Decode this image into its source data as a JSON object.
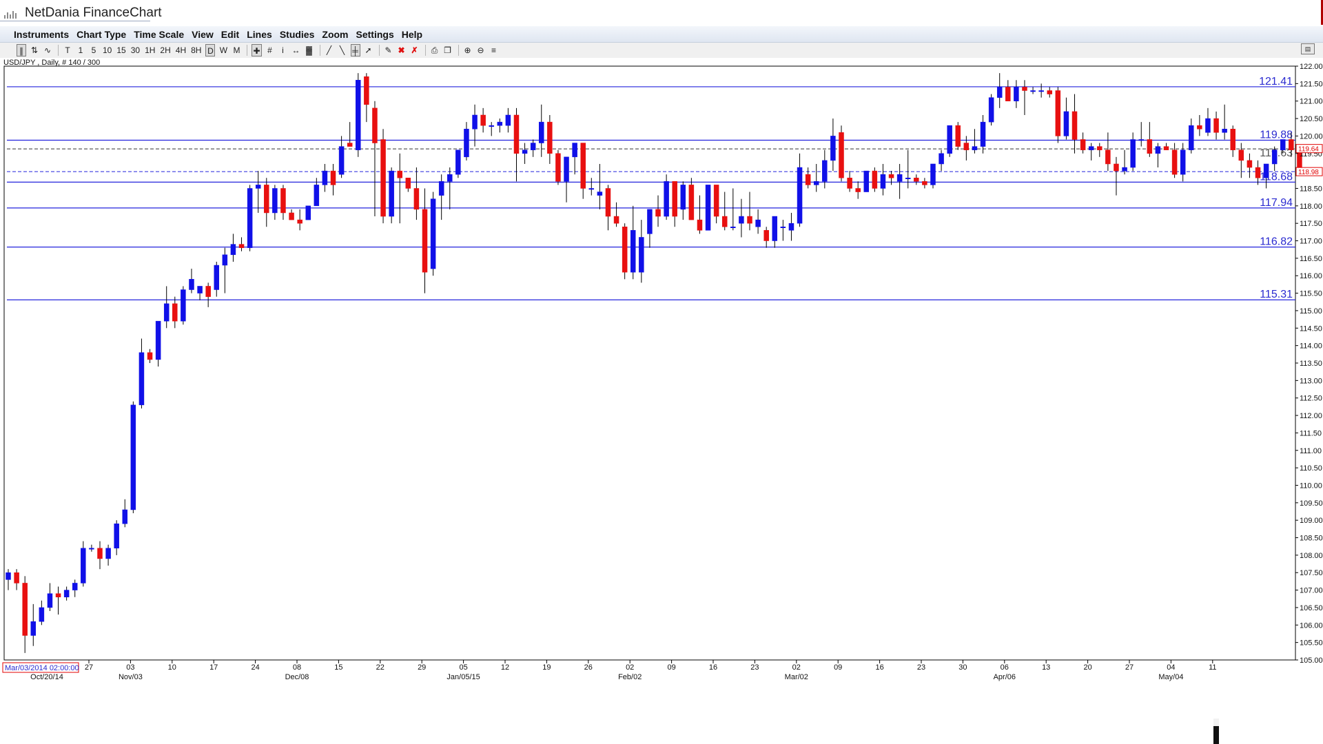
{
  "app": {
    "title": "NetDania FinanceChart"
  },
  "menu": [
    "Instruments",
    "Chart Type",
    "Time Scale",
    "View",
    "Edit",
    "Lines",
    "Studies",
    "Zoom",
    "Settings",
    "Help"
  ],
  "toolbar": {
    "timeframes": [
      "T",
      "1",
      "5",
      "10",
      "15",
      "30",
      "1H",
      "2H",
      "4H",
      "8H",
      "D",
      "W",
      "M"
    ],
    "active_timeframe": "D"
  },
  "symbol_label": "USD/JPY , Daily, # 140 / 300",
  "colors": {
    "up": "#1010e8",
    "down": "#e81010",
    "line": "#2222dd",
    "text_blue": "#2a2ad0",
    "price_red": "#e00000"
  },
  "chart_data": {
    "type": "candlestick",
    "title": "",
    "symbol": "USD/JPY",
    "interval": "Daily",
    "ylim": [
      105.0,
      122.0
    ],
    "y_ticks": [
      "122.00",
      "121.50",
      "121.00",
      "120.50",
      "120.00",
      "119.50",
      "119.00",
      "118.50",
      "118.00",
      "117.50",
      "117.00",
      "116.50",
      "116.00",
      "115.50",
      "115.00",
      "114.50",
      "114.00",
      "113.50",
      "113.00",
      "112.50",
      "112.00",
      "111.50",
      "111.00",
      "110.50",
      "110.00",
      "109.50",
      "109.00",
      "108.50",
      "108.00",
      "107.50",
      "107.00",
      "106.50",
      "106.00",
      "105.50",
      "105.00"
    ],
    "x_ticks": [
      {
        "label": "27",
        "sub": ""
      },
      {
        "label": "03",
        "sub": "Nov/03"
      },
      {
        "label": "10",
        "sub": ""
      },
      {
        "label": "17",
        "sub": ""
      },
      {
        "label": "24",
        "sub": ""
      },
      {
        "label": "08",
        "sub": "Dec/08"
      },
      {
        "label": "15",
        "sub": ""
      },
      {
        "label": "22",
        "sub": ""
      },
      {
        "label": "29",
        "sub": ""
      },
      {
        "label": "05",
        "sub": "Jan/05/15"
      },
      {
        "label": "12",
        "sub": ""
      },
      {
        "label": "19",
        "sub": ""
      },
      {
        "label": "26",
        "sub": ""
      },
      {
        "label": "02",
        "sub": "Feb/02"
      },
      {
        "label": "09",
        "sub": ""
      },
      {
        "label": "16",
        "sub": ""
      },
      {
        "label": "23",
        "sub": ""
      },
      {
        "label": "02",
        "sub": "Mar/02"
      },
      {
        "label": "09",
        "sub": ""
      },
      {
        "label": "16",
        "sub": ""
      },
      {
        "label": "23",
        "sub": ""
      },
      {
        "label": "30",
        "sub": ""
      },
      {
        "label": "06",
        "sub": "Apr/06"
      },
      {
        "label": "13",
        "sub": ""
      },
      {
        "label": "20",
        "sub": ""
      },
      {
        "label": "27",
        "sub": ""
      },
      {
        "label": "04",
        "sub": "May/04"
      },
      {
        "label": "11",
        "sub": ""
      }
    ],
    "x_first_sub": "Oct/20/14",
    "cursor_date_label": "Mar/03/2014 02:00:00",
    "horizontal_lines": [
      {
        "value": 121.41,
        "label": "121.41"
      },
      {
        "value": 119.88,
        "label": "119.88"
      },
      {
        "value": 118.68,
        "label": "118.68"
      },
      {
        "value": 117.94,
        "label": "117.94"
      },
      {
        "value": 116.82,
        "label": "116.82"
      },
      {
        "value": 115.31,
        "label": "115.31"
      }
    ],
    "dashed_lines": [
      {
        "value": 119.63,
        "label": "119.63"
      },
      {
        "value": 118.98,
        "label": "118.98"
      }
    ],
    "price_tags": [
      {
        "value": 119.64,
        "label": "119.64"
      },
      {
        "value": 118.98,
        "label": "118.98"
      }
    ],
    "candles": [
      [
        107.3,
        107.6,
        107.0,
        107.5
      ],
      [
        107.5,
        107.6,
        107.0,
        107.2
      ],
      [
        107.2,
        107.4,
        105.2,
        105.7
      ],
      [
        105.7,
        106.6,
        105.4,
        106.1
      ],
      [
        106.1,
        106.7,
        106.0,
        106.5
      ],
      [
        106.5,
        107.2,
        106.4,
        106.9
      ],
      [
        106.9,
        107.1,
        106.3,
        106.8
      ],
      [
        106.8,
        107.1,
        106.7,
        107.0
      ],
      [
        107.0,
        107.3,
        106.8,
        107.2
      ],
      [
        107.2,
        108.4,
        107.1,
        108.2
      ],
      [
        108.2,
        108.3,
        108.1,
        108.2
      ],
      [
        108.2,
        108.4,
        107.6,
        107.9
      ],
      [
        107.9,
        108.3,
        107.7,
        108.2
      ],
      [
        108.2,
        109.0,
        108.0,
        108.9
      ],
      [
        108.9,
        109.6,
        108.8,
        109.3
      ],
      [
        109.3,
        112.4,
        109.2,
        112.3
      ],
      [
        112.3,
        114.2,
        112.2,
        113.8
      ],
      [
        113.8,
        113.9,
        113.5,
        113.6
      ],
      [
        113.6,
        114.7,
        113.4,
        114.7
      ],
      [
        114.7,
        115.7,
        114.5,
        115.2
      ],
      [
        115.2,
        115.4,
        114.5,
        114.7
      ],
      [
        114.7,
        115.7,
        114.6,
        115.6
      ],
      [
        115.6,
        116.2,
        115.5,
        115.9
      ],
      [
        115.5,
        115.7,
        115.3,
        115.7
      ],
      [
        115.7,
        115.8,
        115.1,
        115.4
      ],
      [
        115.6,
        116.4,
        115.4,
        116.3
      ],
      [
        116.3,
        116.8,
        115.5,
        116.6
      ],
      [
        116.6,
        117.2,
        116.4,
        116.9
      ],
      [
        116.9,
        117.1,
        116.7,
        116.8
      ],
      [
        116.8,
        118.6,
        116.7,
        118.5
      ],
      [
        118.5,
        119.0,
        117.8,
        118.6
      ],
      [
        118.6,
        118.8,
        117.4,
        117.8
      ],
      [
        117.8,
        118.6,
        117.6,
        118.5
      ],
      [
        118.5,
        118.6,
        117.6,
        117.8
      ],
      [
        117.8,
        117.9,
        117.6,
        117.6
      ],
      [
        117.6,
        117.9,
        117.3,
        117.5
      ],
      [
        117.6,
        118.0,
        117.6,
        118.0
      ],
      [
        118.0,
        118.8,
        118.0,
        118.6
      ],
      [
        118.6,
        119.2,
        118.4,
        119.0
      ],
      [
        119.0,
        119.2,
        118.3,
        118.6
      ],
      [
        118.9,
        120.0,
        118.8,
        119.7
      ],
      [
        119.8,
        120.4,
        119.7,
        119.7
      ],
      [
        119.6,
        121.8,
        119.4,
        121.6
      ],
      [
        121.7,
        121.8,
        120.4,
        120.9
      ],
      [
        120.8,
        121.0,
        117.7,
        119.8
      ],
      [
        119.9,
        120.2,
        117.5,
        117.7
      ],
      [
        117.7,
        119.1,
        117.5,
        119.0
      ],
      [
        119.0,
        119.5,
        117.5,
        118.8
      ],
      [
        118.8,
        118.5,
        118.4,
        118.5
      ],
      [
        118.5,
        119.1,
        117.6,
        117.9
      ],
      [
        117.9,
        118.5,
        115.5,
        116.1
      ],
      [
        116.2,
        118.4,
        116.0,
        118.2
      ],
      [
        118.3,
        118.9,
        117.6,
        118.7
      ],
      [
        118.7,
        119.1,
        117.9,
        118.9
      ],
      [
        118.9,
        119.6,
        118.8,
        119.6
      ],
      [
        119.4,
        120.4,
        119.3,
        120.2
      ],
      [
        120.2,
        120.9,
        119.7,
        120.6
      ],
      [
        120.6,
        120.8,
        120.1,
        120.3
      ],
      [
        120.3,
        120.4,
        120.0,
        120.3
      ],
      [
        120.3,
        120.5,
        120.1,
        120.4
      ],
      [
        120.3,
        120.8,
        120.1,
        120.6
      ],
      [
        120.6,
        120.8,
        118.7,
        119.5
      ],
      [
        119.5,
        119.8,
        119.2,
        119.6
      ],
      [
        119.6,
        119.9,
        119.4,
        119.8
      ],
      [
        119.8,
        120.9,
        119.4,
        120.4
      ],
      [
        120.4,
        120.6,
        119.2,
        119.5
      ],
      [
        119.5,
        119.6,
        118.6,
        118.7
      ],
      [
        118.7,
        119.4,
        118.1,
        119.4
      ],
      [
        119.4,
        119.8,
        118.9,
        119.8
      ],
      [
        119.8,
        119.8,
        118.2,
        118.5
      ],
      [
        118.5,
        118.8,
        118.3,
        118.5
      ],
      [
        118.3,
        119.2,
        117.9,
        118.4
      ],
      [
        118.5,
        118.6,
        117.3,
        117.7
      ],
      [
        117.7,
        118.1,
        117.4,
        117.5
      ],
      [
        117.4,
        117.5,
        115.9,
        116.1
      ],
      [
        116.1,
        118.0,
        115.9,
        117.3
      ],
      [
        116.1,
        117.6,
        115.8,
        117.1
      ],
      [
        117.2,
        117.9,
        116.8,
        117.9
      ],
      [
        117.9,
        118.3,
        117.4,
        117.7
      ],
      [
        117.7,
        118.9,
        117.6,
        118.7
      ],
      [
        118.7,
        118.7,
        117.4,
        117.7
      ],
      [
        117.9,
        118.7,
        117.6,
        118.6
      ],
      [
        118.6,
        118.8,
        117.6,
        117.6
      ],
      [
        117.6,
        118.3,
        117.2,
        117.3
      ],
      [
        117.3,
        118.6,
        117.3,
        118.6
      ],
      [
        118.6,
        118.5,
        117.5,
        117.7
      ],
      [
        117.7,
        118.4,
        117.3,
        117.4
      ],
      [
        117.4,
        118.5,
        117.3,
        117.4
      ],
      [
        117.5,
        118.2,
        117.1,
        117.7
      ],
      [
        117.7,
        118.4,
        117.3,
        117.5
      ],
      [
        117.4,
        117.9,
        117.2,
        117.6
      ],
      [
        117.3,
        117.4,
        116.8,
        117.0
      ],
      [
        117.0,
        117.6,
        116.8,
        117.7
      ],
      [
        117.4,
        117.6,
        117.0,
        117.4
      ],
      [
        117.3,
        117.8,
        117.0,
        117.5
      ],
      [
        117.5,
        119.5,
        117.4,
        119.1
      ],
      [
        118.9,
        119.1,
        118.5,
        118.6
      ],
      [
        118.6,
        119.2,
        118.4,
        118.7
      ],
      [
        118.7,
        119.6,
        118.5,
        119.3
      ],
      [
        119.3,
        120.5,
        119.0,
        120.0
      ],
      [
        120.1,
        120.3,
        118.7,
        118.8
      ],
      [
        118.8,
        119.0,
        118.4,
        118.5
      ],
      [
        118.5,
        118.7,
        118.2,
        118.4
      ],
      [
        118.4,
        119.0,
        118.4,
        119.0
      ],
      [
        119.0,
        119.1,
        118.4,
        118.5
      ],
      [
        118.5,
        119.2,
        118.3,
        118.9
      ],
      [
        118.9,
        119.0,
        118.6,
        118.8
      ],
      [
        118.7,
        119.2,
        118.2,
        118.9
      ],
      [
        118.8,
        119.6,
        118.5,
        118.8
      ],
      [
        118.8,
        118.9,
        118.6,
        118.7
      ],
      [
        118.7,
        118.8,
        118.5,
        118.6
      ],
      [
        118.6,
        119.2,
        118.5,
        119.2
      ],
      [
        119.2,
        119.6,
        119.0,
        119.5
      ],
      [
        119.5,
        120.3,
        119.4,
        120.3
      ],
      [
        120.3,
        120.4,
        119.6,
        119.7
      ],
      [
        119.8,
        120.0,
        119.3,
        119.6
      ],
      [
        119.6,
        120.2,
        119.5,
        119.7
      ],
      [
        119.7,
        120.6,
        119.5,
        120.4
      ],
      [
        120.4,
        121.2,
        120.3,
        121.1
      ],
      [
        121.1,
        121.8,
        120.8,
        121.4
      ],
      [
        121.4,
        121.6,
        121.0,
        121.0
      ],
      [
        121.0,
        121.6,
        120.8,
        121.4
      ],
      [
        121.4,
        121.6,
        120.6,
        121.3
      ],
      [
        121.3,
        121.4,
        121.2,
        121.3
      ],
      [
        121.3,
        121.5,
        121.1,
        121.3
      ],
      [
        121.3,
        121.4,
        121.1,
        121.2
      ],
      [
        121.3,
        121.4,
        119.8,
        120.0
      ],
      [
        120.0,
        121.1,
        119.9,
        120.7
      ],
      [
        120.7,
        121.2,
        119.5,
        119.9
      ],
      [
        119.9,
        120.1,
        119.5,
        119.6
      ],
      [
        119.6,
        119.8,
        119.3,
        119.7
      ],
      [
        119.7,
        119.8,
        119.4,
        119.6
      ],
      [
        119.6,
        120.1,
        119.0,
        119.2
      ],
      [
        119.2,
        119.4,
        118.3,
        119.0
      ],
      [
        119.0,
        119.6,
        118.9,
        119.1
      ],
      [
        119.1,
        120.1,
        119.0,
        119.9
      ],
      [
        119.9,
        120.4,
        119.7,
        119.9
      ],
      [
        119.9,
        120.4,
        119.4,
        119.5
      ],
      [
        119.5,
        119.8,
        119.1,
        119.7
      ],
      [
        119.7,
        119.8,
        119.6,
        119.6
      ],
      [
        119.6,
        119.8,
        118.8,
        118.9
      ],
      [
        118.9,
        119.8,
        118.7,
        119.6
      ],
      [
        119.6,
        120.5,
        119.5,
        120.3
      ],
      [
        120.3,
        120.6,
        120.0,
        120.2
      ],
      [
        120.1,
        120.8,
        120.0,
        120.5
      ],
      [
        120.5,
        120.7,
        119.9,
        120.1
      ],
      [
        120.1,
        120.9,
        119.9,
        120.2
      ],
      [
        120.2,
        120.3,
        119.4,
        119.6
      ],
      [
        119.6,
        119.8,
        118.8,
        119.3
      ],
      [
        119.3,
        119.5,
        118.8,
        119.1
      ],
      [
        119.1,
        119.3,
        118.6,
        118.8
      ],
      [
        118.8,
        119.2,
        118.5,
        119.2
      ],
      [
        119.2,
        119.7,
        119.0,
        119.6
      ],
      [
        119.6,
        119.9,
        119.5,
        119.9
      ],
      [
        119.9,
        120.1,
        119.4,
        119.6
      ],
      [
        119.6,
        119.6,
        118.9,
        119.0
      ]
    ]
  }
}
